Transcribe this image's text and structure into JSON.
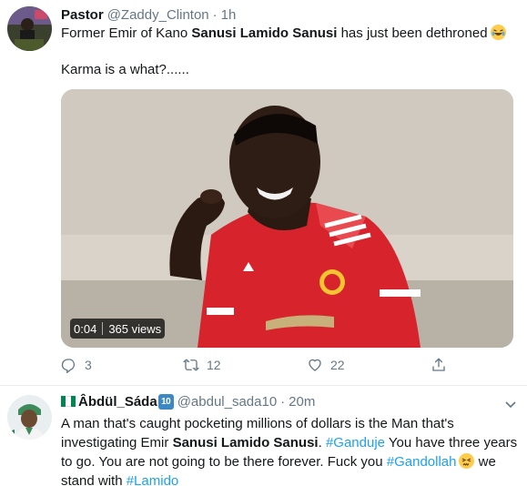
{
  "tweet1": {
    "display_name": "Pastor",
    "handle": "@Zaddy_Clinton",
    "dot": "·",
    "time": "1h",
    "text_pre": "Former Emir of Kano ",
    "text_bold": "Sanusi Lamido Sanusi",
    "text_post": " has just been dethroned",
    "emoji": "rolling-on-the-floor-laughing",
    "text_line2": "Karma is a what?......",
    "video": {
      "time": "0:04",
      "views": "365 views"
    },
    "actions": {
      "reply_count": "3",
      "retweet_count": "12",
      "like_count": "22"
    }
  },
  "tweet2": {
    "display_name": "Âbdül_Sáda",
    "badge": "10",
    "flag": "nigeria-flag",
    "handle": "@abdul_sada10",
    "dot": "·",
    "time": "20m",
    "t1": "A man that's caught pocketing millions of dollars is the Man that's investigating Emir ",
    "t_bold": "Sanusi Lamido Sanusi",
    "t2": ". ",
    "hashtag1": "#Ganduje",
    "t3": " You have three years to go. You are not going to be there forever. Fuck you ",
    "hashtag2": "#Gandollah",
    "emoji": "persevering-face",
    "t4": " we stand with ",
    "hashtag3": "#Lamido"
  },
  "colors": {
    "link": "#1da1f2",
    "secondary": "#657786",
    "text": "#14171a",
    "jersey": "#d7242c"
  }
}
